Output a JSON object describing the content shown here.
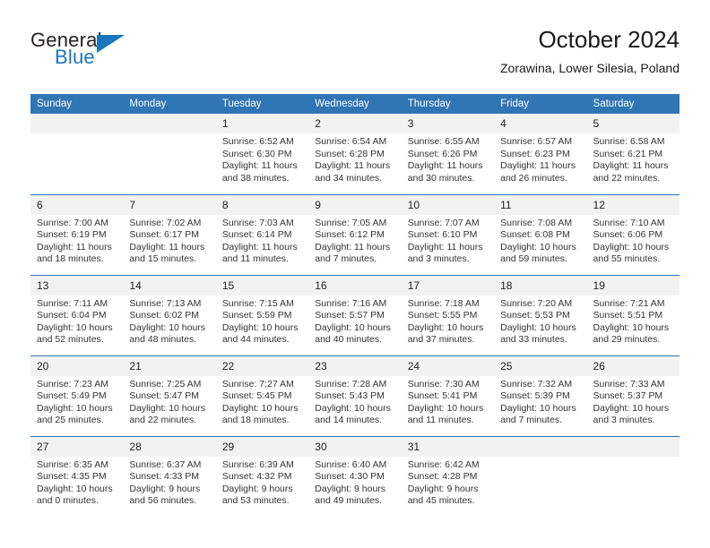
{
  "brand": {
    "name_top": "General",
    "name_bottom": "Blue",
    "color_dark": "#231f20",
    "color_blue": "#1b76bc",
    "triangle_icon": "triangle-icon"
  },
  "header": {
    "title": "October 2024",
    "subtitle": "Zorawina, Lower Silesia, Poland"
  },
  "theme": {
    "header_blue": "#3075b4",
    "daynum_band": "#f2f2f2",
    "text": "#333333"
  },
  "weekdays": [
    "Sunday",
    "Monday",
    "Tuesday",
    "Wednesday",
    "Thursday",
    "Friday",
    "Saturday"
  ],
  "labels": {
    "sunrise": "Sunrise:",
    "sunset": "Sunset:",
    "daylight": "Daylight:"
  },
  "weeks": [
    [
      {
        "day": ""
      },
      {
        "day": ""
      },
      {
        "day": "1",
        "sunrise": "Sunrise: 6:52 AM",
        "sunset": "Sunset: 6:30 PM",
        "daylight": "Daylight: 11 hours and 38 minutes."
      },
      {
        "day": "2",
        "sunrise": "Sunrise: 6:54 AM",
        "sunset": "Sunset: 6:28 PM",
        "daylight": "Daylight: 11 hours and 34 minutes."
      },
      {
        "day": "3",
        "sunrise": "Sunrise: 6:55 AM",
        "sunset": "Sunset: 6:26 PM",
        "daylight": "Daylight: 11 hours and 30 minutes."
      },
      {
        "day": "4",
        "sunrise": "Sunrise: 6:57 AM",
        "sunset": "Sunset: 6:23 PM",
        "daylight": "Daylight: 11 hours and 26 minutes."
      },
      {
        "day": "5",
        "sunrise": "Sunrise: 6:58 AM",
        "sunset": "Sunset: 6:21 PM",
        "daylight": "Daylight: 11 hours and 22 minutes."
      }
    ],
    [
      {
        "day": "6",
        "sunrise": "Sunrise: 7:00 AM",
        "sunset": "Sunset: 6:19 PM",
        "daylight": "Daylight: 11 hours and 18 minutes."
      },
      {
        "day": "7",
        "sunrise": "Sunrise: 7:02 AM",
        "sunset": "Sunset: 6:17 PM",
        "daylight": "Daylight: 11 hours and 15 minutes."
      },
      {
        "day": "8",
        "sunrise": "Sunrise: 7:03 AM",
        "sunset": "Sunset: 6:14 PM",
        "daylight": "Daylight: 11 hours and 11 minutes."
      },
      {
        "day": "9",
        "sunrise": "Sunrise: 7:05 AM",
        "sunset": "Sunset: 6:12 PM",
        "daylight": "Daylight: 11 hours and 7 minutes."
      },
      {
        "day": "10",
        "sunrise": "Sunrise: 7:07 AM",
        "sunset": "Sunset: 6:10 PM",
        "daylight": "Daylight: 11 hours and 3 minutes."
      },
      {
        "day": "11",
        "sunrise": "Sunrise: 7:08 AM",
        "sunset": "Sunset: 6:08 PM",
        "daylight": "Daylight: 10 hours and 59 minutes."
      },
      {
        "day": "12",
        "sunrise": "Sunrise: 7:10 AM",
        "sunset": "Sunset: 6:06 PM",
        "daylight": "Daylight: 10 hours and 55 minutes."
      }
    ],
    [
      {
        "day": "13",
        "sunrise": "Sunrise: 7:11 AM",
        "sunset": "Sunset: 6:04 PM",
        "daylight": "Daylight: 10 hours and 52 minutes."
      },
      {
        "day": "14",
        "sunrise": "Sunrise: 7:13 AM",
        "sunset": "Sunset: 6:02 PM",
        "daylight": "Daylight: 10 hours and 48 minutes."
      },
      {
        "day": "15",
        "sunrise": "Sunrise: 7:15 AM",
        "sunset": "Sunset: 5:59 PM",
        "daylight": "Daylight: 10 hours and 44 minutes."
      },
      {
        "day": "16",
        "sunrise": "Sunrise: 7:16 AM",
        "sunset": "Sunset: 5:57 PM",
        "daylight": "Daylight: 10 hours and 40 minutes."
      },
      {
        "day": "17",
        "sunrise": "Sunrise: 7:18 AM",
        "sunset": "Sunset: 5:55 PM",
        "daylight": "Daylight: 10 hours and 37 minutes."
      },
      {
        "day": "18",
        "sunrise": "Sunrise: 7:20 AM",
        "sunset": "Sunset: 5:53 PM",
        "daylight": "Daylight: 10 hours and 33 minutes."
      },
      {
        "day": "19",
        "sunrise": "Sunrise: 7:21 AM",
        "sunset": "Sunset: 5:51 PM",
        "daylight": "Daylight: 10 hours and 29 minutes."
      }
    ],
    [
      {
        "day": "20",
        "sunrise": "Sunrise: 7:23 AM",
        "sunset": "Sunset: 5:49 PM",
        "daylight": "Daylight: 10 hours and 25 minutes."
      },
      {
        "day": "21",
        "sunrise": "Sunrise: 7:25 AM",
        "sunset": "Sunset: 5:47 PM",
        "daylight": "Daylight: 10 hours and 22 minutes."
      },
      {
        "day": "22",
        "sunrise": "Sunrise: 7:27 AM",
        "sunset": "Sunset: 5:45 PM",
        "daylight": "Daylight: 10 hours and 18 minutes."
      },
      {
        "day": "23",
        "sunrise": "Sunrise: 7:28 AM",
        "sunset": "Sunset: 5:43 PM",
        "daylight": "Daylight: 10 hours and 14 minutes."
      },
      {
        "day": "24",
        "sunrise": "Sunrise: 7:30 AM",
        "sunset": "Sunset: 5:41 PM",
        "daylight": "Daylight: 10 hours and 11 minutes."
      },
      {
        "day": "25",
        "sunrise": "Sunrise: 7:32 AM",
        "sunset": "Sunset: 5:39 PM",
        "daylight": "Daylight: 10 hours and 7 minutes."
      },
      {
        "day": "26",
        "sunrise": "Sunrise: 7:33 AM",
        "sunset": "Sunset: 5:37 PM",
        "daylight": "Daylight: 10 hours and 3 minutes."
      }
    ],
    [
      {
        "day": "27",
        "sunrise": "Sunrise: 6:35 AM",
        "sunset": "Sunset: 4:35 PM",
        "daylight": "Daylight: 10 hours and 0 minutes."
      },
      {
        "day": "28",
        "sunrise": "Sunrise: 6:37 AM",
        "sunset": "Sunset: 4:33 PM",
        "daylight": "Daylight: 9 hours and 56 minutes."
      },
      {
        "day": "29",
        "sunrise": "Sunrise: 6:39 AM",
        "sunset": "Sunset: 4:32 PM",
        "daylight": "Daylight: 9 hours and 53 minutes."
      },
      {
        "day": "30",
        "sunrise": "Sunrise: 6:40 AM",
        "sunset": "Sunset: 4:30 PM",
        "daylight": "Daylight: 9 hours and 49 minutes."
      },
      {
        "day": "31",
        "sunrise": "Sunrise: 6:42 AM",
        "sunset": "Sunset: 4:28 PM",
        "daylight": "Daylight: 9 hours and 45 minutes."
      },
      {
        "day": ""
      },
      {
        "day": ""
      }
    ]
  ]
}
